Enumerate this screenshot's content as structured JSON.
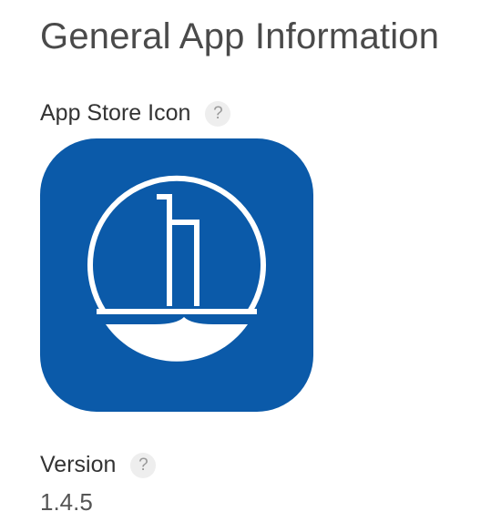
{
  "page": {
    "title": "General App Information"
  },
  "app_store_icon": {
    "label": "App Store Icon",
    "help_glyph": "?",
    "icon_name": "app-logo-icon",
    "background_color": "#0b5aa9",
    "foreground_color": "#ffffff"
  },
  "version": {
    "label": "Version",
    "help_glyph": "?",
    "value": "1.4.5"
  }
}
